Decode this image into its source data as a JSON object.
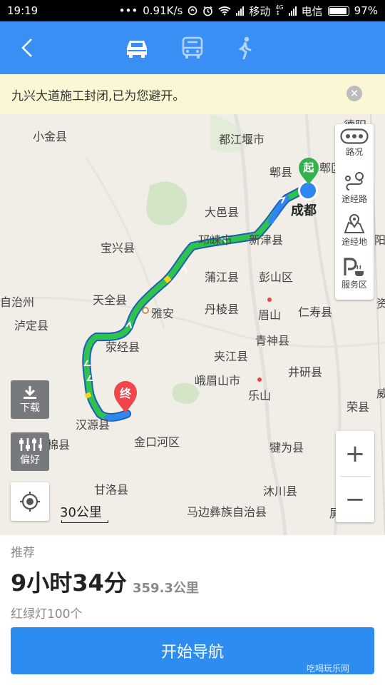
{
  "status_bar": {
    "time": "19:19",
    "speed": "0.91K/s",
    "carrier1": "移动",
    "carrier2": "电信",
    "battery": "97%",
    "battery_level": 0.97,
    "icons": [
      "more-dots-icon",
      "data-sync-icon",
      "alarm-icon",
      "wifi-icon",
      "signal-icon",
      "4g-icon",
      "battery-icon"
    ]
  },
  "nav": {
    "back_icon": "back-arrow-icon",
    "modes": [
      "car-icon",
      "bus-icon",
      "walk-icon"
    ],
    "active_mode": "car"
  },
  "notice": {
    "text": "九兴大道施工封闭,已为您避开。",
    "close_icon": "close-icon"
  },
  "map": {
    "places": [
      {
        "name": "小金县"
      },
      {
        "name": "都江堰市"
      },
      {
        "name": "德阳"
      },
      {
        "name": "郫县"
      },
      {
        "name": "郫区"
      },
      {
        "name": "成都"
      },
      {
        "name": "大邑县"
      },
      {
        "name": "邛崃市"
      },
      {
        "name": "新津县"
      },
      {
        "name": "宝兴县"
      },
      {
        "name": "蒲江县"
      },
      {
        "name": "彭山区"
      },
      {
        "name": "自治州"
      },
      {
        "name": "天全县"
      },
      {
        "name": "雅安"
      },
      {
        "name": "丹棱县"
      },
      {
        "name": "眉山"
      },
      {
        "name": "仁寿县"
      },
      {
        "name": "泸定县"
      },
      {
        "name": "青神县"
      },
      {
        "name": "荥经县"
      },
      {
        "name": "夹江县"
      },
      {
        "name": "井研县"
      },
      {
        "name": "峨眉山市"
      },
      {
        "name": "乐山"
      },
      {
        "name": "汉源县"
      },
      {
        "name": "荣县"
      },
      {
        "name": "石棉县"
      },
      {
        "name": "金口河区"
      },
      {
        "name": "犍为县"
      },
      {
        "name": "甘洛县"
      },
      {
        "name": "沐川县"
      },
      {
        "name": "马边彝族自治县"
      },
      {
        "name": "屏山县"
      },
      {
        "name": "阳"
      },
      {
        "name": "资"
      },
      {
        "name": "威"
      }
    ],
    "start_marker": "起",
    "end_marker": "终",
    "route_color": "#2f86f2",
    "tools": [
      {
        "label": "路况",
        "icon": "traffic-icon"
      },
      {
        "label": "途经路",
        "icon": "route-via-icon"
      },
      {
        "label": "途经地",
        "icon": "map-pin-icon"
      },
      {
        "label": "服务区",
        "icon": "service-area-icon"
      }
    ],
    "download_label": "下载",
    "download_icon": "download-icon",
    "preference_label": "偏好",
    "preference_icon": "sliders-icon",
    "locate_icon": "locate-icon",
    "scale": "30公里",
    "zoom_in": "+",
    "zoom_out": "−"
  },
  "route": {
    "label": "推荐",
    "duration": "9小时34分",
    "distance": "359.3公里",
    "traffic_lights": "红绿灯100个"
  },
  "start_button": "开始导航",
  "watermark": "吃喝玩乐网"
}
